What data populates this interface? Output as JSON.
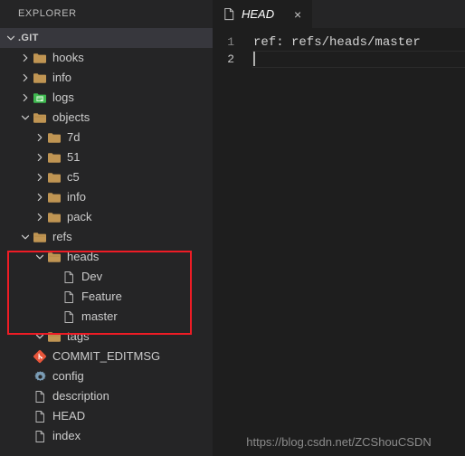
{
  "sidebar": {
    "title": "EXPLORER",
    "section": {
      "label": ".GIT",
      "twisty": "chevron-down-icon"
    },
    "tree": [
      {
        "label": "hooks",
        "indent": 1,
        "twisty": "collapsed",
        "icon": "folder-icon"
      },
      {
        "label": "info",
        "indent": 1,
        "twisty": "collapsed",
        "icon": "folder-icon"
      },
      {
        "label": "logs",
        "indent": 1,
        "twisty": "collapsed",
        "icon": "folder-green-icon"
      },
      {
        "label": "objects",
        "indent": 1,
        "twisty": "expanded",
        "icon": "folder-open-icon"
      },
      {
        "label": "7d",
        "indent": 2,
        "twisty": "collapsed",
        "icon": "folder-icon"
      },
      {
        "label": "51",
        "indent": 2,
        "twisty": "collapsed",
        "icon": "folder-icon"
      },
      {
        "label": "c5",
        "indent": 2,
        "twisty": "collapsed",
        "icon": "folder-icon"
      },
      {
        "label": "info",
        "indent": 2,
        "twisty": "collapsed",
        "icon": "folder-icon"
      },
      {
        "label": "pack",
        "indent": 2,
        "twisty": "collapsed",
        "icon": "folder-icon"
      },
      {
        "label": "refs",
        "indent": 1,
        "twisty": "expanded",
        "icon": "folder-open-icon"
      },
      {
        "label": "heads",
        "indent": 2,
        "twisty": "expanded",
        "icon": "folder-open-icon"
      },
      {
        "label": "Dev",
        "indent": 3,
        "twisty": "none",
        "icon": "file-icon"
      },
      {
        "label": "Feature",
        "indent": 3,
        "twisty": "none",
        "icon": "file-icon"
      },
      {
        "label": "master",
        "indent": 3,
        "twisty": "none",
        "icon": "file-icon"
      },
      {
        "label": "tags",
        "indent": 2,
        "twisty": "expanded",
        "icon": "folder-open-icon"
      },
      {
        "label": "COMMIT_EDITMSG",
        "indent": 1,
        "twisty": "none",
        "icon": "git-icon"
      },
      {
        "label": "config",
        "indent": 1,
        "twisty": "none",
        "icon": "gear-icon"
      },
      {
        "label": "description",
        "indent": 1,
        "twisty": "none",
        "icon": "file-icon"
      },
      {
        "label": "HEAD",
        "indent": 1,
        "twisty": "none",
        "icon": "file-icon"
      },
      {
        "label": "index",
        "indent": 1,
        "twisty": "none",
        "icon": "file-icon"
      }
    ],
    "highlight": {
      "name": "red-annotation-box",
      "color": "#ee1c25"
    }
  },
  "editor": {
    "tab": {
      "label": "HEAD",
      "icon": "file-icon",
      "close": "×"
    },
    "lines": [
      {
        "number": "1",
        "text": "ref: refs/heads/master",
        "active": false
      },
      {
        "number": "2",
        "text": "",
        "active": true
      }
    ]
  },
  "watermark": "https://blog.csdn.net/ZCShouCSDN",
  "colors": {
    "sidebar_bg": "#252526",
    "editor_bg": "#1e1e1e",
    "section_bg": "#37373d",
    "text": "#cccccc",
    "folder": "#c09553",
    "folder_green": "#3fb950",
    "git_red": "#e8553a",
    "gear_blue": "#7a9cb5",
    "accent_red": "#ee1c25",
    "gutter": "#858585"
  }
}
